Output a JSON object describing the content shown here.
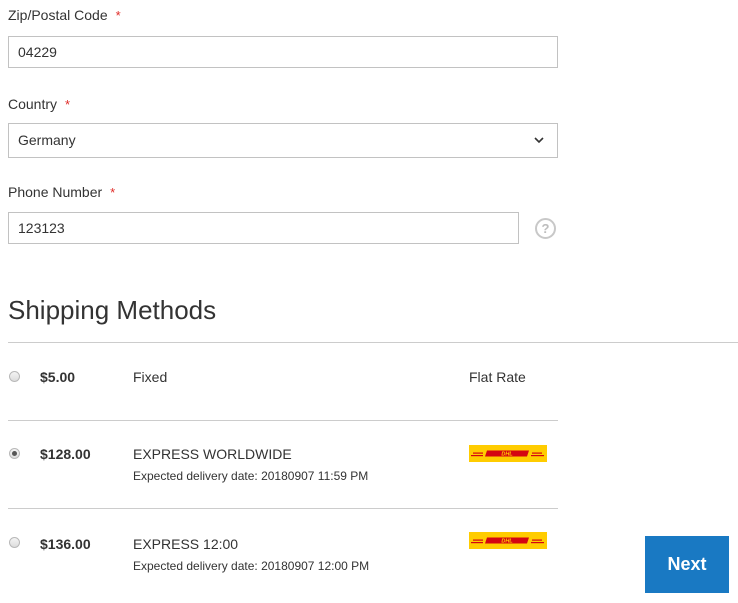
{
  "form": {
    "zip": {
      "label": "Zip/Postal Code",
      "required_mark": "*",
      "value": "04229"
    },
    "country": {
      "label": "Country",
      "required_mark": "*",
      "selected": "Germany"
    },
    "phone": {
      "label": "Phone Number",
      "required_mark": "*",
      "value": "123123",
      "help_glyph": "?"
    }
  },
  "shipping": {
    "title": "Shipping Methods",
    "methods": [
      {
        "price": "$5.00",
        "method": "Fixed",
        "note": "",
        "carrier": "Flat Rate",
        "carrier_icon": "flat-rate-text",
        "selected": false
      },
      {
        "price": "$128.00",
        "method": "EXPRESS WORLDWIDE",
        "note": "Expected delivery date: 20180907 11:59 PM",
        "carrier": "DHL",
        "carrier_icon": "dhl-logo",
        "selected": true
      },
      {
        "price": "$136.00",
        "method": "EXPRESS 12:00",
        "note": "Expected delivery date: 20180907 12:00 PM",
        "carrier": "DHL",
        "carrier_icon": "dhl-logo",
        "selected": false
      }
    ]
  },
  "actions": {
    "next_label": "Next"
  },
  "colors": {
    "required": "#e02b27",
    "primary_button": "#1979c3",
    "dhl_yellow": "#ffcc00",
    "dhl_red": "#d40511",
    "border": "#c2c2c2"
  }
}
